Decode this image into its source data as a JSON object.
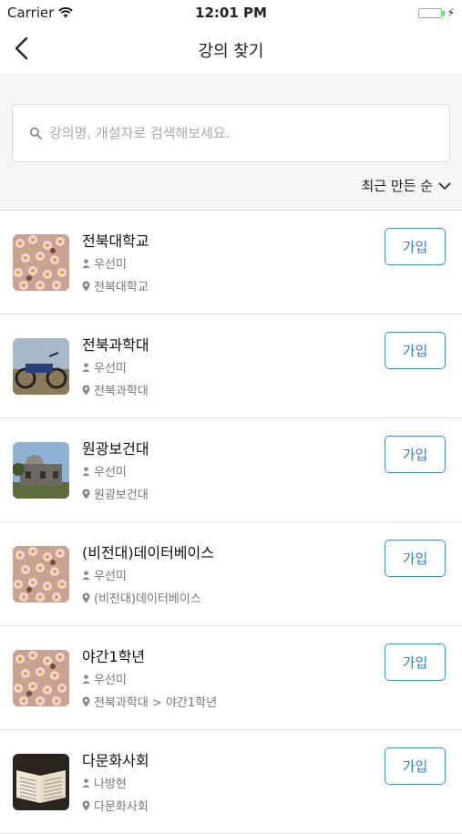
{
  "status_bar": {
    "carrier": "Carrier",
    "time": "12:01 PM"
  },
  "nav": {
    "title": "강의 찾기"
  },
  "search": {
    "placeholder": "강의명, 개설자로 검색해보세요."
  },
  "sort": {
    "label": "최근 만든 순"
  },
  "join_label": "가입",
  "courses": [
    {
      "name": "전북대학교",
      "owner": "우선미",
      "location": "전북대학교",
      "thumb": "flowers"
    },
    {
      "name": "전북과학대",
      "owner": "우선미",
      "location": "전북과학대",
      "thumb": "motorcycle"
    },
    {
      "name": "원광보건대",
      "owner": "우선미",
      "location": "원광보건대",
      "thumb": "building"
    },
    {
      "name": "(비전대)데이터베이스",
      "owner": "우선미",
      "location": "(비전대)데이터베이스",
      "thumb": "flowers"
    },
    {
      "name": "야간1학년",
      "owner": "우선미",
      "location": "전북과학대 > 야간1학년",
      "thumb": "flowers"
    },
    {
      "name": "다문화사회",
      "owner": "나방현",
      "location": "다문화사회",
      "thumb": "book"
    }
  ]
}
